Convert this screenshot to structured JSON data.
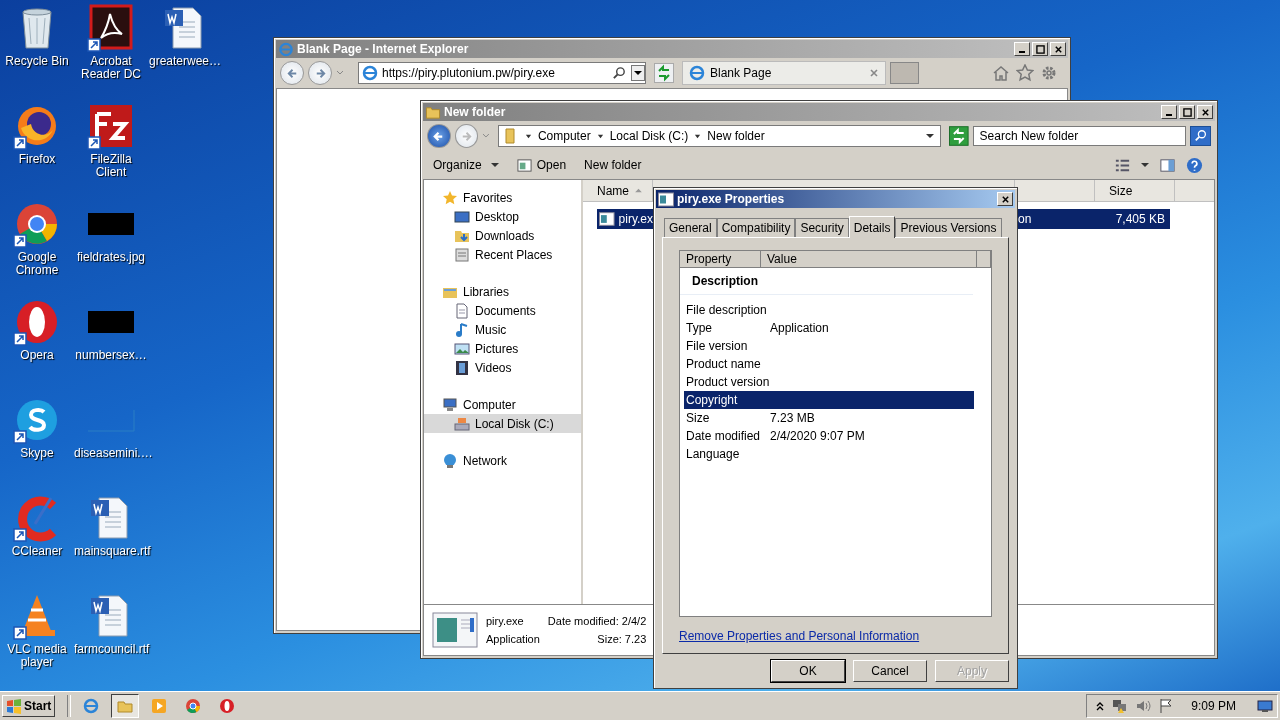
{
  "desktop_rows": [
    {
      "icons": [
        {
          "label": "Recycle Bin",
          "kind": "recycle",
          "shortcut": false
        },
        {
          "label": "Acrobat Reader DC",
          "kind": "acrobat",
          "shortcut": true
        },
        {
          "label": "greaterwee…",
          "kind": "word",
          "shortcut": false
        }
      ]
    },
    {
      "icons": [
        {
          "label": "Firefox",
          "kind": "firefox",
          "shortcut": true
        },
        {
          "label": "FileZilla Client",
          "kind": "filezilla",
          "shortcut": true
        }
      ]
    },
    {
      "icons": [
        {
          "label": "Google Chrome",
          "kind": "chrome",
          "shortcut": true
        },
        {
          "label": "fieldrates.jpg",
          "kind": "image",
          "shortcut": false
        }
      ]
    },
    {
      "icons": [
        {
          "label": "Opera",
          "kind": "opera",
          "shortcut": true
        },
        {
          "label": "numbersex…",
          "kind": "image",
          "shortcut": false
        }
      ]
    },
    {
      "icons": [
        {
          "label": "Skype",
          "kind": "skype",
          "shortcut": true
        },
        {
          "label": "diseasemini.…",
          "kind": "blank-image",
          "shortcut": false
        }
      ]
    },
    {
      "icons": [
        {
          "label": "CCleaner",
          "kind": "ccleaner",
          "shortcut": true
        },
        {
          "label": "mainsquare.rtf",
          "kind": "word",
          "shortcut": false
        }
      ]
    },
    {
      "icons": [
        {
          "label": "VLC media player",
          "kind": "vlc",
          "shortcut": true
        },
        {
          "label": "farmcouncil.rtf",
          "kind": "word",
          "shortcut": false
        }
      ]
    }
  ],
  "ie_window": {
    "title": "Blank Page - Internet Explorer",
    "address": "https://piry.plutonium.pw/piry.exe",
    "tab": "Blank Page"
  },
  "explorer": {
    "title": "New folder",
    "breadcrumb": [
      "Computer",
      "Local Disk (C:)",
      "New folder"
    ],
    "search": {
      "placeholder": "Search New folder"
    },
    "commands": [
      {
        "label": "Organize",
        "kind": "menu"
      },
      {
        "label": "Open",
        "kind": "action"
      },
      {
        "label": "New folder",
        "kind": "plain"
      }
    ],
    "nav": [
      {
        "label": "Favorites",
        "kind": "star",
        "selected": false,
        "children": [
          {
            "label": "Desktop",
            "kind": "desktop",
            "selected": false
          },
          {
            "label": "Downloads",
            "kind": "downloads",
            "selected": false
          },
          {
            "label": "Recent Places",
            "kind": "recent",
            "selected": false
          }
        ]
      },
      {
        "label": "Libraries",
        "kind": "library",
        "selected": false,
        "children": [
          {
            "label": "Documents",
            "kind": "document",
            "selected": false
          },
          {
            "label": "Music",
            "kind": "music",
            "selected": false
          },
          {
            "label": "Pictures",
            "kind": "pictures",
            "selected": false
          },
          {
            "label": "Videos",
            "kind": "videos",
            "selected": false
          }
        ]
      },
      {
        "label": "Computer",
        "kind": "computer",
        "selected": false,
        "children": [
          {
            "label": "Local Disk (C:)",
            "kind": "disk",
            "selected": true
          }
        ]
      },
      {
        "label": "Network",
        "kind": "network",
        "selected": false
      }
    ],
    "columns": [
      {
        "label": "Name",
        "sorted": true
      },
      {
        "label": "Size",
        "sorted": false
      }
    ],
    "rows": [
      {
        "name": "piry.ex",
        "column_3": "on",
        "size": "7,405 KB",
        "selected": true
      }
    ],
    "details": {
      "name": "piry.exe",
      "type": "Application",
      "date_modified": "Date modified: 2/4/2",
      "size": "Size: 7.23"
    }
  },
  "dialog": {
    "title": "piry.exe Properties",
    "tabs": [
      {
        "label": "General",
        "selected": false
      },
      {
        "label": "Compatibility",
        "selected": false
      },
      {
        "label": "Security",
        "selected": false
      },
      {
        "label": "Details",
        "selected": true
      },
      {
        "label": "Previous Versions",
        "selected": false
      }
    ],
    "columns": [
      "Property",
      "Value"
    ],
    "section": "Description",
    "properties": [
      {
        "property": "File description",
        "selected": false
      },
      {
        "property": "Type",
        "value": "Application",
        "selected": false
      },
      {
        "property": "File version",
        "selected": false
      },
      {
        "property": "Product name",
        "selected": false
      },
      {
        "property": "Product version",
        "selected": false
      },
      {
        "property": "Copyright",
        "selected": true
      },
      {
        "property": "Size",
        "value": "7.23 MB",
        "selected": false
      },
      {
        "property": "Date modified",
        "value": "2/4/2020 9:07 PM",
        "selected": false
      },
      {
        "property": "Language",
        "selected": false
      }
    ],
    "link": "Remove Properties and Personal Information",
    "buttons": [
      {
        "label": "OK",
        "kind": "default"
      },
      {
        "label": "Cancel",
        "kind": "normal"
      },
      {
        "label": "Apply",
        "kind": "disabled"
      }
    ]
  },
  "taskbar": {
    "start": "Start",
    "apps": [
      {
        "kind": "ie",
        "active": false
      },
      {
        "kind": "explorer",
        "active": true
      },
      {
        "kind": "media",
        "active": false
      },
      {
        "kind": "chrome",
        "active": false
      },
      {
        "kind": "opera",
        "active": false
      }
    ],
    "time": "9:09 PM"
  }
}
